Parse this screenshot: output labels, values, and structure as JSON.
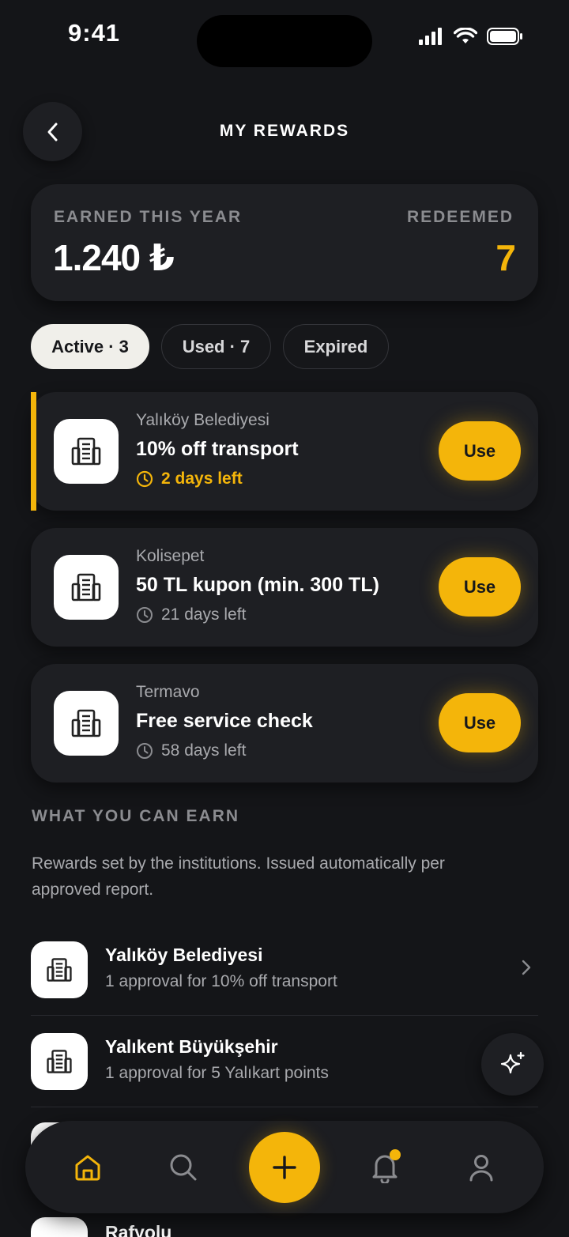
{
  "status_bar": {
    "time": "9:41"
  },
  "header": {
    "title": "MY REWARDS"
  },
  "summary": {
    "earned_label": "EARNED THIS YEAR",
    "earned_value": "1.240 ₺",
    "redeemed_label": "REDEEMED",
    "redeemed_value": "7"
  },
  "tabs": [
    {
      "label": "Active · 3",
      "active": true
    },
    {
      "label": "Used · 7",
      "active": false
    },
    {
      "label": "Expired",
      "active": false
    }
  ],
  "rewards": [
    {
      "org": "Yalıköy Belediyesi",
      "title": "10% off transport",
      "time_left": "2 days left",
      "urgent": true,
      "action": "Use"
    },
    {
      "org": "Kolisepet",
      "title": "50 TL kupon (min. 300 TL)",
      "time_left": "21 days left",
      "urgent": false,
      "action": "Use"
    },
    {
      "org": "Termavo",
      "title": "Free service check",
      "time_left": "58 days left",
      "urgent": false,
      "action": "Use"
    }
  ],
  "earn_section": {
    "title": "WHAT YOU CAN EARN",
    "description": "Rewards set by the institutions. Issued automatically per approved report.",
    "items": [
      {
        "name": "Yalıköy Belediyesi",
        "desc": "1 approval for 10% off transport"
      },
      {
        "name": "Yalıkent Büyükşehir",
        "desc": "1 approval for 5 Yalıkart points"
      },
      {
        "name": "Rafyolu",
        "desc": ""
      }
    ]
  },
  "colors": {
    "accent": "#f4b50a",
    "background": "#141518",
    "card": "#1e1f23"
  },
  "icons": {
    "back": "chevron-left-icon",
    "institution": "building-icon",
    "clock": "clock-icon",
    "chevron": "chevron-right-icon",
    "sparkle": "sparkle-icon",
    "nav": [
      "home-icon",
      "search-icon",
      "plus-icon",
      "bell-icon",
      "user-icon"
    ]
  }
}
